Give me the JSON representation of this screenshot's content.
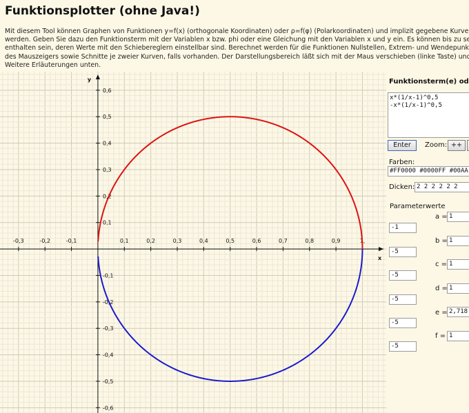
{
  "page": {
    "title": "Funktionsplotter (ohne Java!)",
    "intro_lines": [
      "Mit diesem Tool können Graphen von Funktionen y=f(x) (orthogonale Koordinaten) oder ρ=f(φ) (Polarkoordinaten) und implizit gegebene Kurven gez",
      "werden. Geben Sie dazu den Funktionsterm mit der Variablen x bzw. phi oder eine Gleichung mit den Variablen x und y ein. Es können bis zu sechs P",
      "enthalten sein, deren Werte mit den Schiebereglern einstellbar sind. Berechnet werden für die Funktionen Nullstellen, Extrem- und Wendepunkte in",
      "des Mauszeigers sowie Schnitte je zweier Kurven, falls vorhanden. Der Darstellungsbereich läßt sich mit der Maus verschieben (linke Taste) und ska",
      "Weitere Erläuterungen unten."
    ]
  },
  "panel": {
    "heading": "Funktionsterm(e) oder",
    "terms": [
      "x*(1/x-1)^0,5",
      "-x*(1/x-1)^0,5"
    ],
    "enter_label": "Enter",
    "zoom_label": "Zoom:",
    "zoom_in_label": "++",
    "colors_label": "Farben:",
    "colors_value": "#FF0000 #0000FF #00AA",
    "widths_label": "Dicken:",
    "widths_value": "2 2 2 2 2 2",
    "params_heading": "Parameterwerte",
    "params": [
      {
        "name": "a =",
        "value": "1",
        "min": "-1"
      },
      {
        "name": "b =",
        "value": "1",
        "min": "-5"
      },
      {
        "name": "c =",
        "value": "1",
        "min": "-5"
      },
      {
        "name": "d =",
        "value": "1",
        "min": "-5"
      },
      {
        "name": "e =",
        "value": "2,718",
        "min": "-5"
      },
      {
        "name": "f =",
        "value": "1",
        "min": "-5"
      }
    ]
  },
  "chart_data": {
    "type": "line",
    "xlabel": "x",
    "ylabel": "y",
    "xlim": [
      -0.37,
      1.09
    ],
    "ylim": [
      -0.62,
      0.67
    ],
    "x_ticks": [
      -0.3,
      -0.2,
      -0.1,
      0.1,
      0.2,
      0.3,
      0.4,
      0.5,
      0.6,
      0.7,
      0.8,
      0.9,
      1
    ],
    "x_tick_labels": [
      "-0,3",
      "-0,2",
      "-0,1",
      "0,1",
      "0,2",
      "0,3",
      "0,4",
      "0,5",
      "0,6",
      "0,7",
      "0,8",
      "0,9",
      "1,"
    ],
    "y_ticks": [
      0.6,
      0.5,
      0.4,
      0.3,
      0.2,
      0.1,
      -0.1,
      -0.2,
      -0.3,
      -0.4,
      -0.5,
      -0.6
    ],
    "y_tick_labels": [
      "0,6",
      "0,5",
      "0,4",
      "0,3",
      "0,2",
      "0,1",
      "-0,1",
      "-0,2",
      "-0,3",
      "-0,4",
      "-0,5",
      "-0,6"
    ],
    "grid": true,
    "series": [
      {
        "color": "#dd1111",
        "x_range": [
          0.0008,
          1
        ],
        "formula": "x*(1/x-1)^0.5",
        "sign": 1
      },
      {
        "color": "#1a1acc",
        "x_range": [
          0.0008,
          1
        ],
        "formula": "-x*(1/x-1)^0.5",
        "sign": -1
      }
    ]
  }
}
